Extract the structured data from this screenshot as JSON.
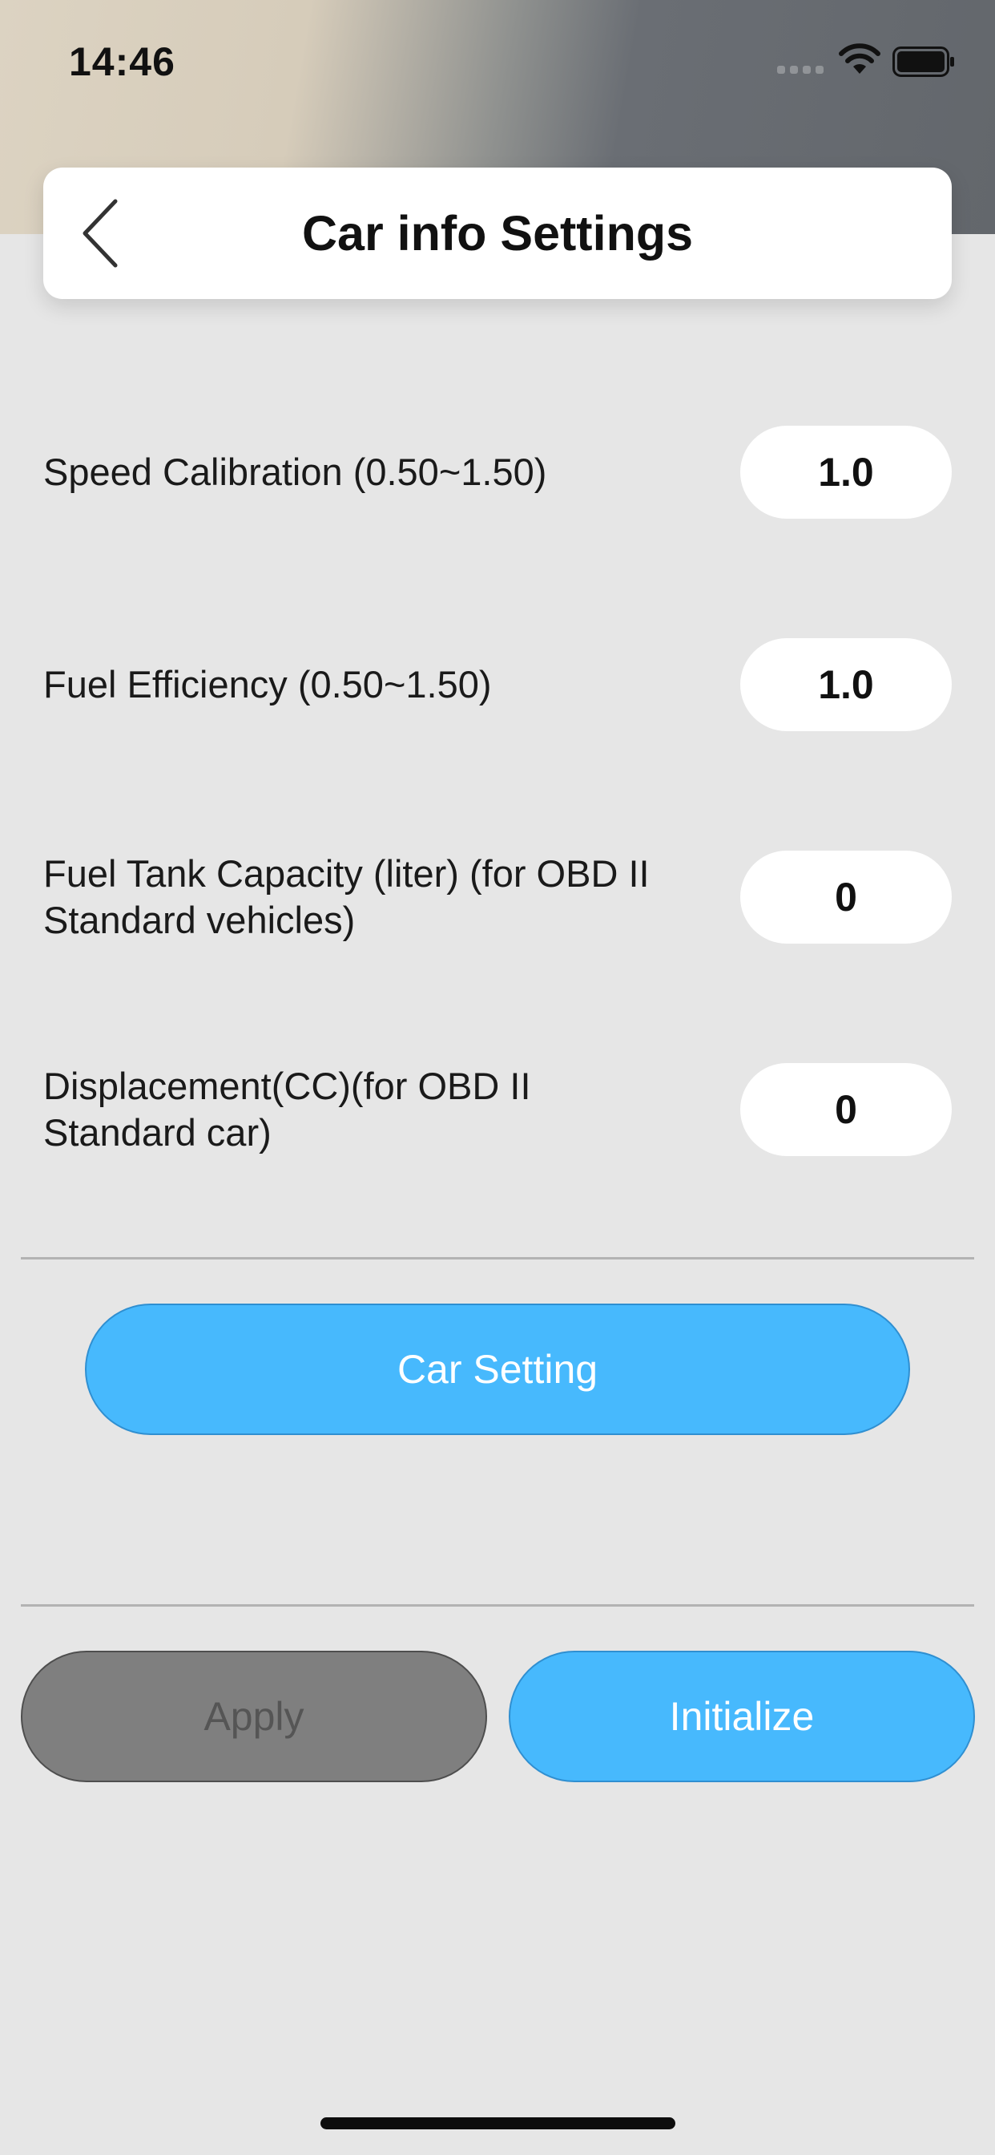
{
  "status_bar": {
    "time": "14:46",
    "icons": [
      "cellular-signal-icon",
      "wifi-icon",
      "battery-icon"
    ]
  },
  "header": {
    "title": "Car info Settings",
    "back_icon": "chevron-left-icon"
  },
  "settings": [
    {
      "label": "Speed Calibration (0.50~1.50)",
      "value": "1.0"
    },
    {
      "label": "Fuel Efficiency (0.50~1.50)",
      "value": "1.0"
    },
    {
      "label": "Fuel Tank Capacity (liter) (for OBD II Standard vehicles)",
      "value": "0"
    },
    {
      "label": "Displacement(CC)(for OBD II Standard car)",
      "value": "0"
    }
  ],
  "buttons": {
    "car_setting": "Car Setting",
    "apply": "Apply",
    "initialize": "Initialize"
  },
  "colors": {
    "accent_blue": "#47b9fd",
    "disabled_gray": "#7f7f7f",
    "background": "#e6e6e6"
  }
}
